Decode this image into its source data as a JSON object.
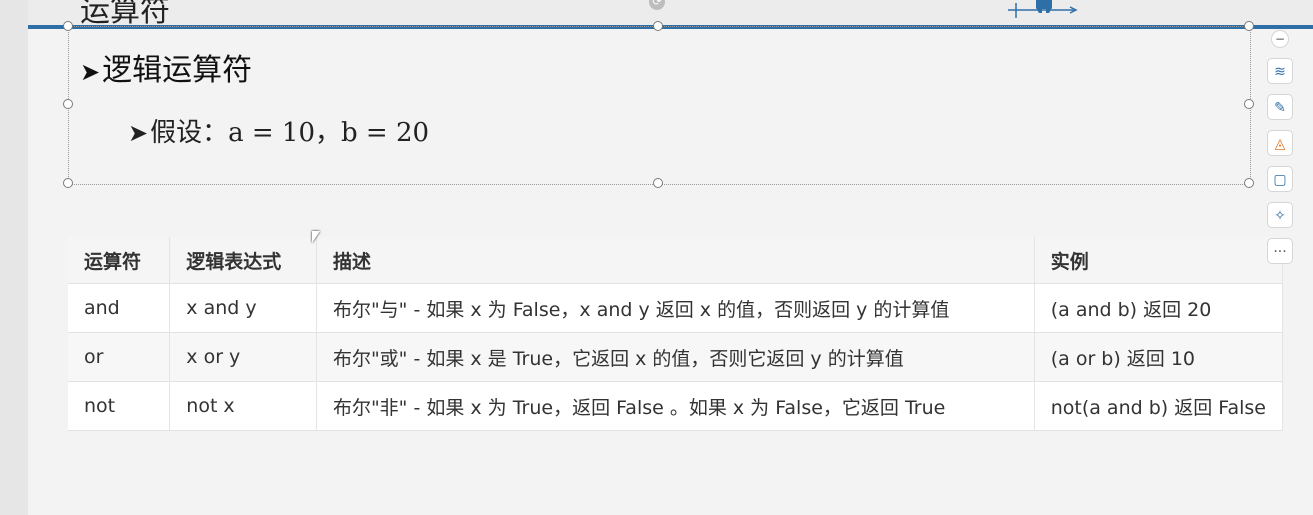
{
  "slide": {
    "top_title": "运算符",
    "heading": "逻辑运算符",
    "bullet_arrow": "➤",
    "assumption": "假设：a = 10，b = 20"
  },
  "table": {
    "headers": [
      "运算符",
      "逻辑表达式",
      "描述",
      "实例"
    ],
    "rows": [
      [
        "and",
        "x and y",
        "布尔\"与\" - 如果 x 为 False，x and y 返回 x 的值，否则返回 y 的计算值",
        "(a and b) 返回 20"
      ],
      [
        "or",
        "x or y",
        "布尔\"或\" - 如果 x 是 True，它返回 x 的值，否则它返回 y 的计算值",
        "(a or b) 返回 10"
      ],
      [
        "not",
        "not x",
        "布尔\"非\" - 如果 x 为 True，返回 False 。如果 x 为 False，它返回 True",
        "not(a and b) 返回 False"
      ]
    ]
  },
  "toolbar": {
    "collapse": "−",
    "layers": "≋",
    "brush": "✎",
    "fill": "◬",
    "frame": "▢",
    "magic": "✧",
    "more": "···"
  },
  "colors": {
    "accent": "#2f6fa8"
  }
}
